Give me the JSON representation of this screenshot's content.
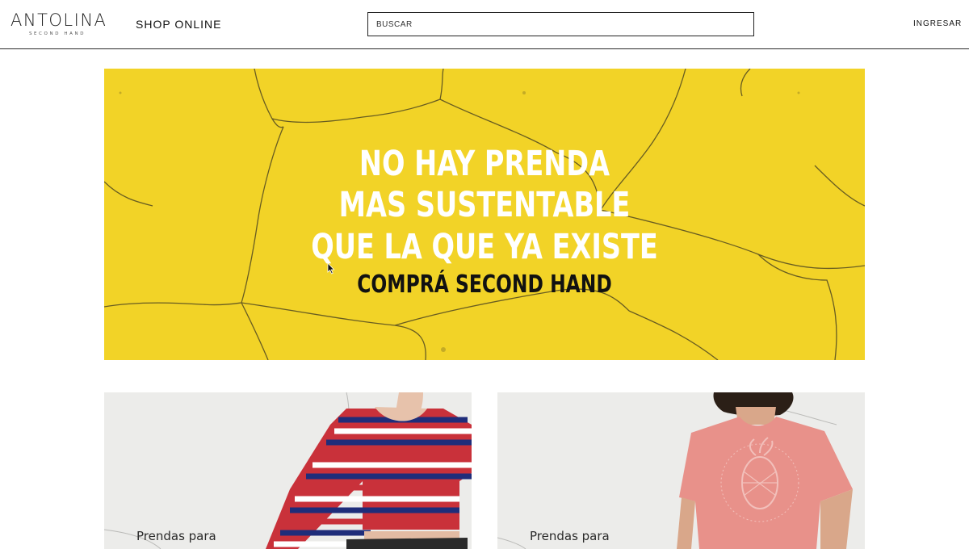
{
  "header": {
    "logo": {
      "name": "ANTOLINA",
      "tagline": "SECOND HAND"
    },
    "nav_shop": "SHOP ONLINE",
    "search": {
      "placeholder": "BUSCAR",
      "value": ""
    },
    "login": "INGRESAR"
  },
  "hero": {
    "line1": "NO HAY PRENDA",
    "line2": "MAS SUSTENTABLE",
    "line3": "QUE LA QUE YA EXISTE",
    "cta": "COMPRÁ SECOND HAND"
  },
  "categories": [
    {
      "label": "Prendas para"
    },
    {
      "label": "Prendas para"
    }
  ],
  "colors": {
    "hero_yellow": "#f2d327",
    "header_border": "#2a2a2a",
    "card_bg": "#ececea"
  },
  "icons": {
    "cursor": "arrow-pointer-icon"
  }
}
